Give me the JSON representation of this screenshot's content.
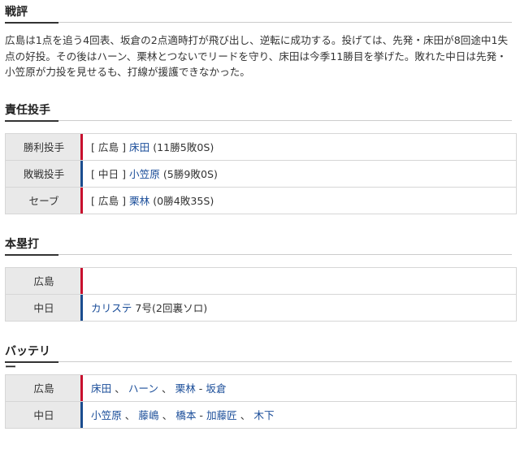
{
  "sections": {
    "review": {
      "title": "戦評"
    },
    "pitchers": {
      "title": "責任投手"
    },
    "homeruns": {
      "title": "本塁打"
    },
    "battery": {
      "title": "バッテリー"
    }
  },
  "summary_text": "広島は1点を追う4回表、坂倉の2点適時打が飛び出し、逆転に成功する。投げては、先発・床田が8回途中1失点の好投。その後はハーン、栗林とつないでリードを守り、床田は今季11勝目を挙げた。敗れた中日は先発・小笠原が力投を見せるも、打線が援護できなかった。",
  "pitchers": [
    {
      "label": "勝利投手",
      "team": "[ 広島 ]",
      "name": "床田",
      "record": "(11勝5敗0S)",
      "color": "#c8102e"
    },
    {
      "label": "敗戦投手",
      "team": "[ 中日 ]",
      "name": "小笠原",
      "record": "(5勝9敗0S)",
      "color": "#1b4d8f"
    },
    {
      "label": "セーブ",
      "team": "[ 広島 ]",
      "name": "栗林",
      "record": "(0勝4敗35S)",
      "color": "#c8102e"
    }
  ],
  "homeruns": [
    {
      "team": "広島",
      "player": "",
      "detail": ""
    },
    {
      "team": "中日",
      "player": "カリステ",
      "detail": "7号(2回裏ソロ)"
    }
  ],
  "battery": {
    "hiroshima": {
      "team": "広島",
      "p1": "床田",
      "p2": "ハーン",
      "p3": "栗林",
      "catcher": "坂倉",
      "sep": "、",
      "dash": " - "
    },
    "chunichi": {
      "team": "中日",
      "p1": "小笠原",
      "p2": "藤嶋",
      "p3": "橋本",
      "c1": "加藤匠",
      "c2": "木下",
      "sep": "、",
      "dash": " - "
    }
  }
}
